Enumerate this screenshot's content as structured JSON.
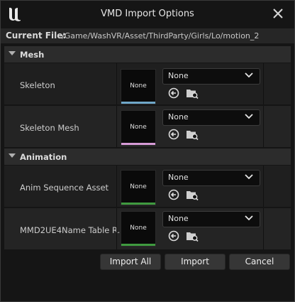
{
  "window": {
    "title": "VMD Import Options",
    "logo_icon": "unreal-logo-icon",
    "close_icon": "close-icon"
  },
  "current_file": {
    "label": "Current File:",
    "value": "/Game/WashVR/Asset/ThirdParty/Girls/Lo/motion_2"
  },
  "sections": [
    {
      "title": "Mesh",
      "rows": [
        {
          "label": "Skeleton",
          "thumb_text": "None",
          "thumb_color": "#6fa7c8",
          "value": "None"
        },
        {
          "label": "Skeleton Mesh",
          "thumb_text": "None",
          "thumb_color": "#d69ad6",
          "value": "None"
        }
      ]
    },
    {
      "title": "Animation",
      "rows": [
        {
          "label": "Anim Sequence Asset",
          "thumb_text": "None",
          "thumb_color": "#3f9a3f",
          "value": "None"
        },
        {
          "label": "MMD2UE4Name Table R...",
          "thumb_text": "None",
          "thumb_color": "#3f9a3f",
          "value": "None"
        }
      ]
    }
  ],
  "buttons": {
    "import_all": "Import All",
    "import": "Import",
    "cancel": "Cancel"
  },
  "icons": {
    "use_selected": "use-selected-arrow-icon",
    "browse": "browse-folder-icon",
    "dropdown": "chevron-down-icon"
  }
}
